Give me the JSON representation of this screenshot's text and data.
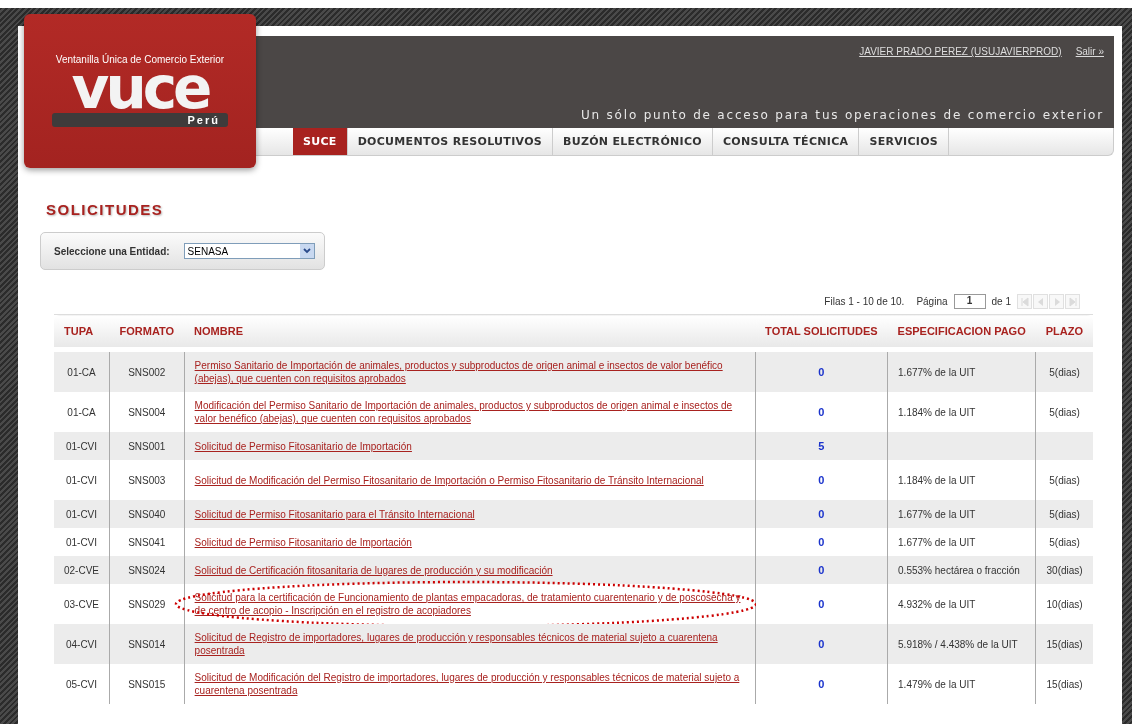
{
  "header": {
    "logo": {
      "subtitle": "Ventanilla Única de Comercio Exterior",
      "name": "vuce",
      "country": "Perú"
    },
    "user": "JAVIER PRADO PEREZ (USUJAVIERPROD)",
    "logout": "Salir »",
    "tagline": "Un sólo punto de acceso para tus operaciones de comercio exterior"
  },
  "nav": [
    {
      "label": "SUCE",
      "selected": true
    },
    {
      "label": "DOCUMENTOS RESOLUTIVOS",
      "selected": false
    },
    {
      "label": "BUZÓN ELECTRÓNICO",
      "selected": false
    },
    {
      "label": "CONSULTA TÉCNICA",
      "selected": false
    },
    {
      "label": "SERVICIOS",
      "selected": false
    }
  ],
  "title": "SOLICITUDES",
  "entity": {
    "label": "Seleccione una Entidad:",
    "value": "SENASA"
  },
  "pager": {
    "rows_text": "Filas 1 - 10 de 10.",
    "page_label": "Página",
    "page_value": "1",
    "of_text": "de 1",
    "buttons": [
      {
        "kind": "first",
        "disabled": true
      },
      {
        "kind": "prev",
        "disabled": true
      },
      {
        "kind": "next",
        "disabled": true
      },
      {
        "kind": "last",
        "disabled": true
      }
    ]
  },
  "table": {
    "columns": [
      "TUPA",
      "FORMATO",
      "NOMBRE",
      "TOTAL SOLICITUDES",
      "ESPECIFICACION PAGO",
      "PLAZO"
    ],
    "rows": [
      {
        "tupa": "01-CA",
        "formato": "SNS002",
        "nombre": "Permiso Sanitario de Importación de animales, productos y subproductos de origen animal e insectos de valor benéfico (abejas), que cuenten con requisitos aprobados",
        "total": "0",
        "pago": "1.677% de la UIT",
        "plazo": "5(dias)",
        "circled": false
      },
      {
        "tupa": "01-CA",
        "formato": "SNS004",
        "nombre": "Modificación del Permiso Sanitario de Importación de animales, productos y subproductos de origen animal e insectos de valor benéfico (abejas), que cuenten con requisitos aprobados",
        "total": "0",
        "pago": "1.184% de la UIT",
        "plazo": "5(dias)",
        "circled": false
      },
      {
        "tupa": "01-CVI",
        "formato": "SNS001",
        "nombre": "Solicitud de Permiso Fitosanitario de Importación",
        "total": "5",
        "circled": false
      },
      {
        "tupa": "01-CVI",
        "formato": "SNS003",
        "nombre": "Solicitud de Modificación del Permiso Fitosanitario de Importación o Permiso Fitosanitario de Tránsito Internacional",
        "total": "0",
        "pago": "1.184% de la UIT",
        "plazo": "5(dias)",
        "circled": false
      },
      {
        "tupa": "01-CVI",
        "formato": "SNS040",
        "nombre": "Solicitud de Permiso Fitosanitario para el Tránsito Internacional",
        "total": "0",
        "pago": "1.677% de la UIT",
        "plazo": "5(dias)",
        "circled": false
      },
      {
        "tupa": "01-CVI",
        "formato": "SNS041",
        "nombre": "Solicitud de Permiso Fitosanitario de Importación",
        "total": "0",
        "pago": "1.677% de la UIT",
        "plazo": "5(dias)",
        "circled": false
      },
      {
        "tupa": "02-CVE",
        "formato": "SNS024",
        "nombre": "Solicitud de Certificación fitosanitaria de lugares de producción y su modificación",
        "total": "0",
        "pago": "0.553% hectárea o fracción",
        "plazo": "30(dias)",
        "circled": false
      },
      {
        "tupa": "03-CVE",
        "formato": "SNS029",
        "nombre": "Solicitud para la certificación de Funcionamiento de plantas empacadoras, de tratamiento cuarentenario y de poscosecha y de centro de acopio - Inscripción en el registro de acopiadores",
        "total": "0",
        "pago": "4.932% de la UIT",
        "plazo": "10(dias)",
        "circled": true
      },
      {
        "tupa": "04-CVI",
        "formato": "SNS014",
        "nombre": "Solicitud de Registro de importadores, lugares de producción y responsables técnicos de material sujeto a cuarentena posentrada",
        "total": "0",
        "pago": "5.918% / 4.438% de la UIT",
        "plazo": "15(dias)",
        "circled": false
      },
      {
        "tupa": "05-CVI",
        "formato": "SNS015",
        "nombre": "Solicitud de Modificación del Registro de importadores, lugares de producción y responsables técnicos de material sujeto a cuarentena posentrada",
        "total": "0",
        "pago": "1.479% de la UIT",
        "plazo": "15(dias)",
        "circled": false
      }
    ]
  }
}
